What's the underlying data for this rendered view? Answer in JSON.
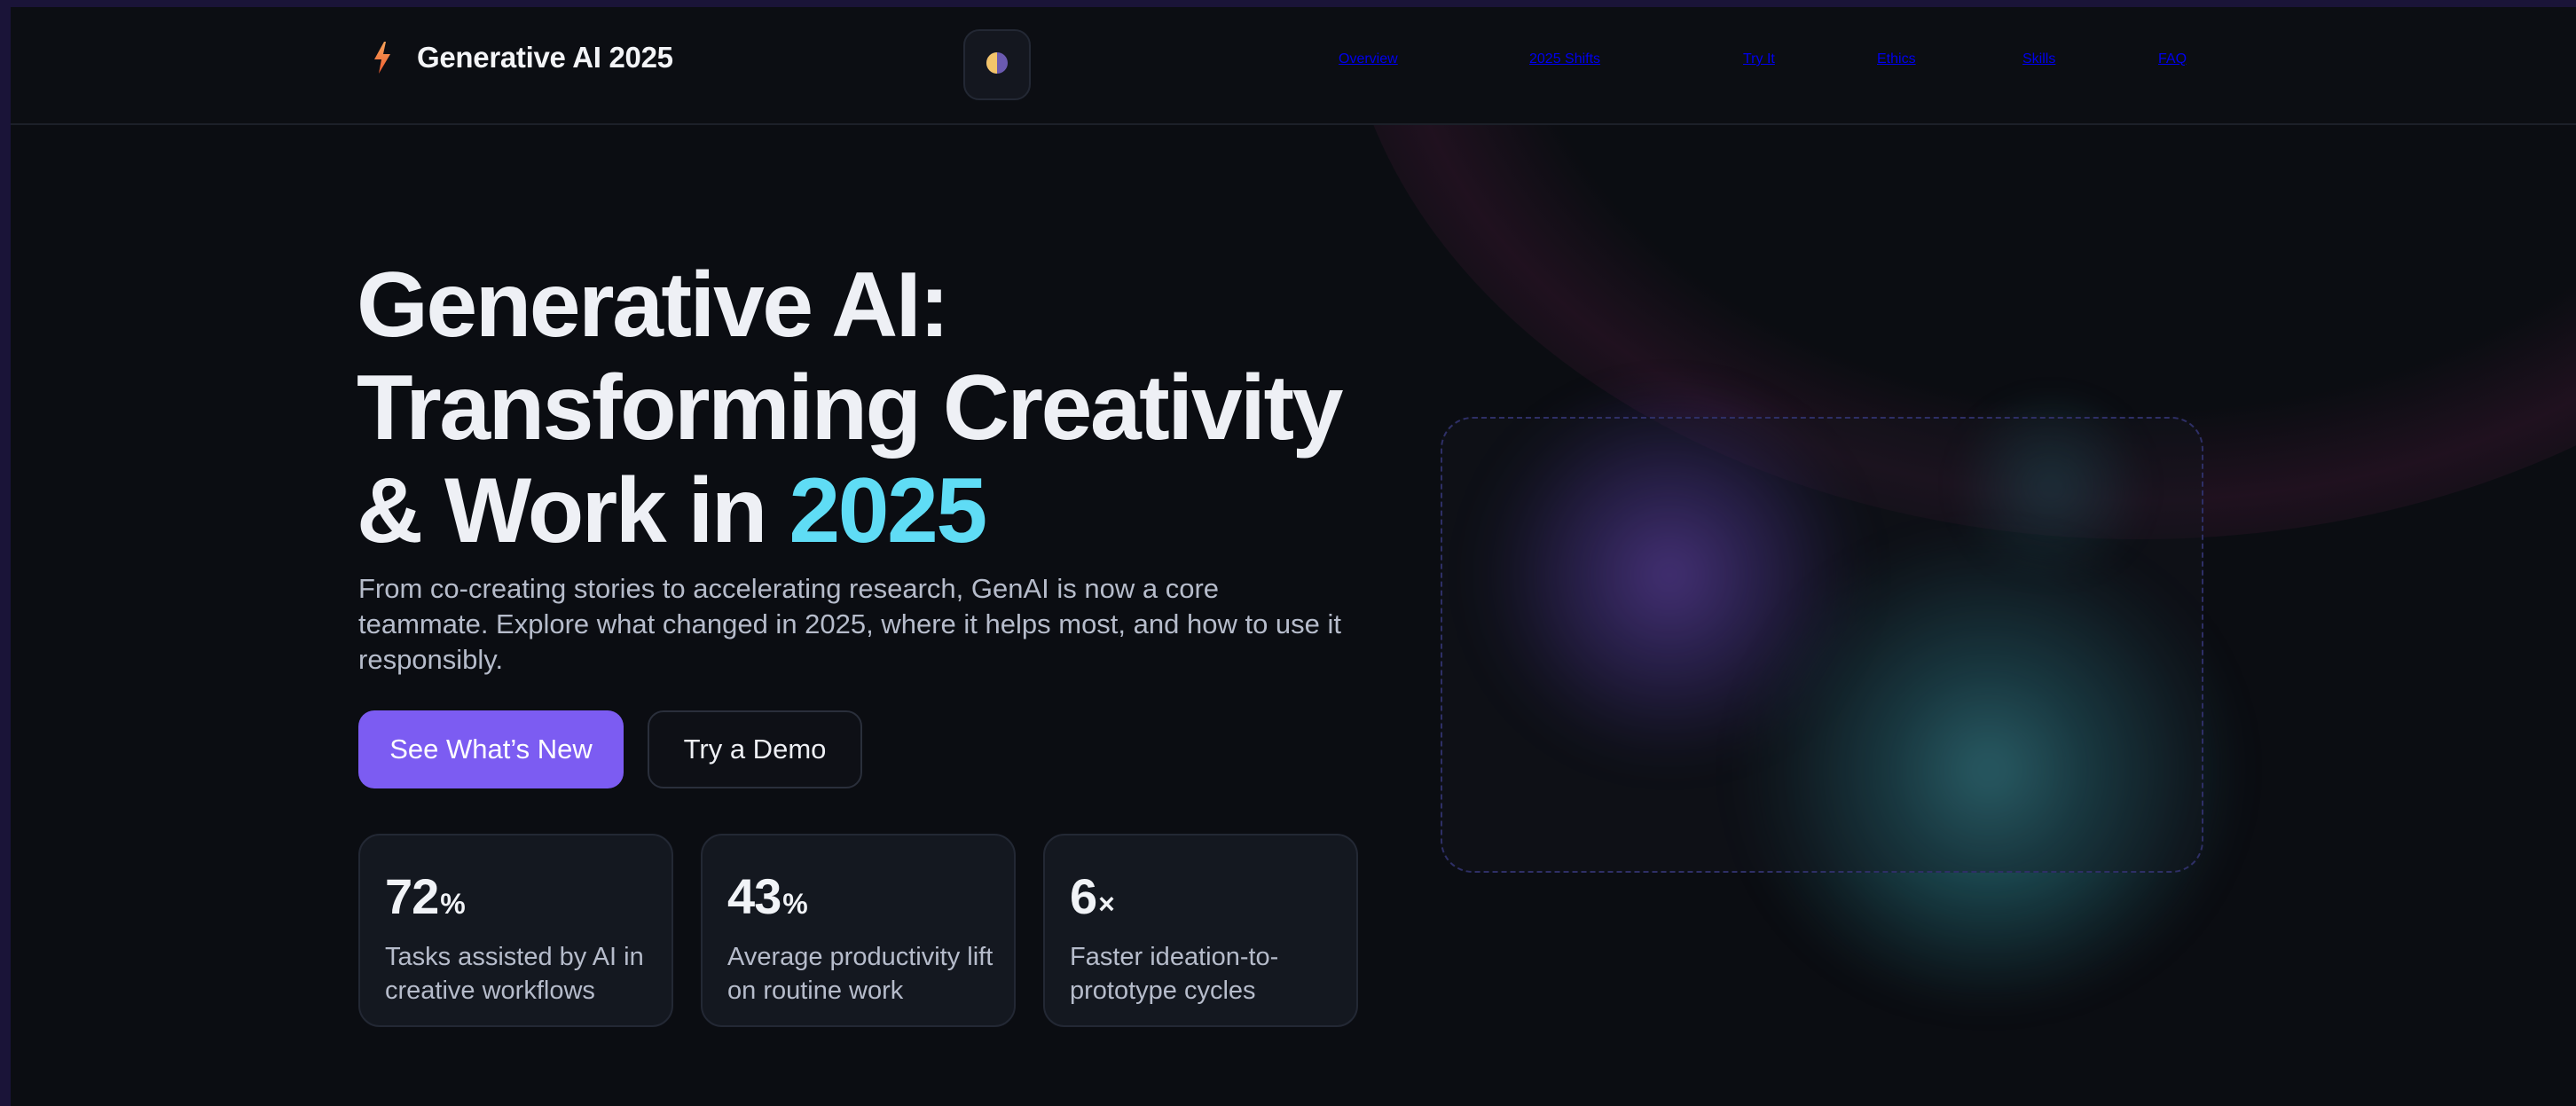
{
  "header": {
    "brand_title": "Generative AI 2025",
    "brand_icon": "bolt-icon",
    "theme_toggle_icon": "half-moon-icon",
    "nav": [
      {
        "label": "Overview"
      },
      {
        "label": "2025 Shifts"
      },
      {
        "label": "Try It"
      },
      {
        "label": "Ethics"
      },
      {
        "label": "Skills"
      },
      {
        "label": "FAQ"
      }
    ]
  },
  "hero": {
    "title_line1": "Generative AI:",
    "title_line2": "Transforming Creativity",
    "title_line3_prefix": "& Work in ",
    "title_line3_accent": "2025",
    "subtitle": "From co-creating stories to accelerating research, GenAI is now a core teammate. Explore what changed in 2025, where it helps most, and how to use it responsibly.",
    "primary_button": "See What’s New",
    "secondary_button": "Try a Demo"
  },
  "stats": [
    {
      "value": "72",
      "unit": "%",
      "label": "Tasks assisted by AI in creative workflows"
    },
    {
      "value": "43",
      "unit": "%",
      "label": "Average productivity lift on routine work"
    },
    {
      "value": "6",
      "unit": "×",
      "label": "Faster ideation-to-prototype cycles"
    }
  ],
  "colors": {
    "background": "#0b0d12",
    "accent_cyan": "#5fdcf5",
    "primary_button": "#7c5cf2",
    "brand_icon": "#f26a3c"
  }
}
